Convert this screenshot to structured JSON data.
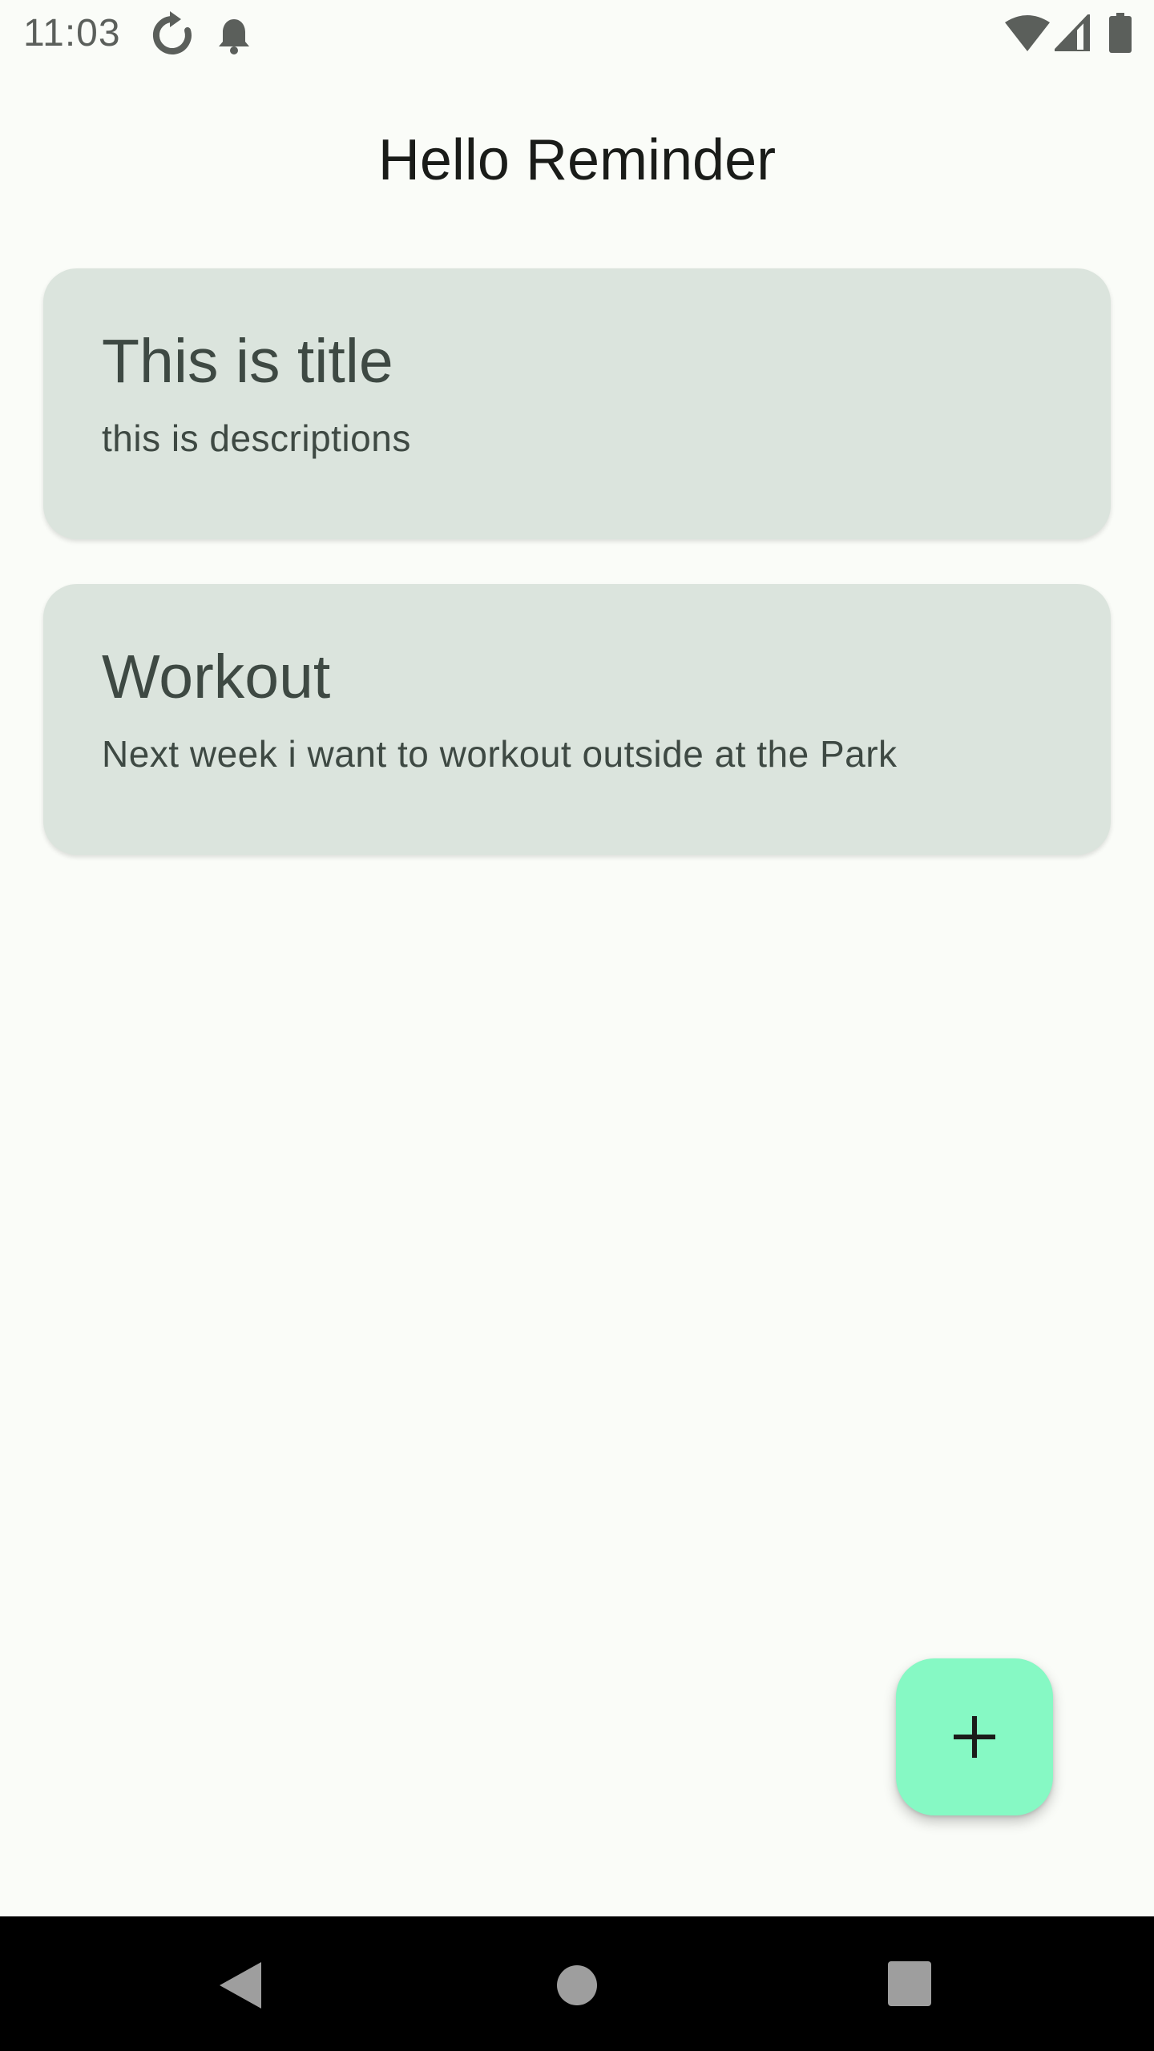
{
  "status_bar": {
    "time": "11:03",
    "icons": [
      "sync-icon",
      "notification-bell-icon",
      "wifi-icon",
      "cellular-signal-icon",
      "battery-icon"
    ]
  },
  "app": {
    "title": "Hello Reminder"
  },
  "reminders": [
    {
      "title": "This is title",
      "description": "this is descriptions"
    },
    {
      "title": "Workout",
      "description": "Next week i want to workout outside at the Park"
    }
  ],
  "fab": {
    "icon": "plus-icon",
    "color": "#86f9c4"
  },
  "nav_bar": {
    "buttons": [
      "back-icon",
      "home-icon",
      "recents-icon"
    ]
  },
  "colors": {
    "background": "#fafcf8",
    "card": "#dbe4dd",
    "card_text": "#3e4943",
    "accent": "#86f9c4"
  }
}
